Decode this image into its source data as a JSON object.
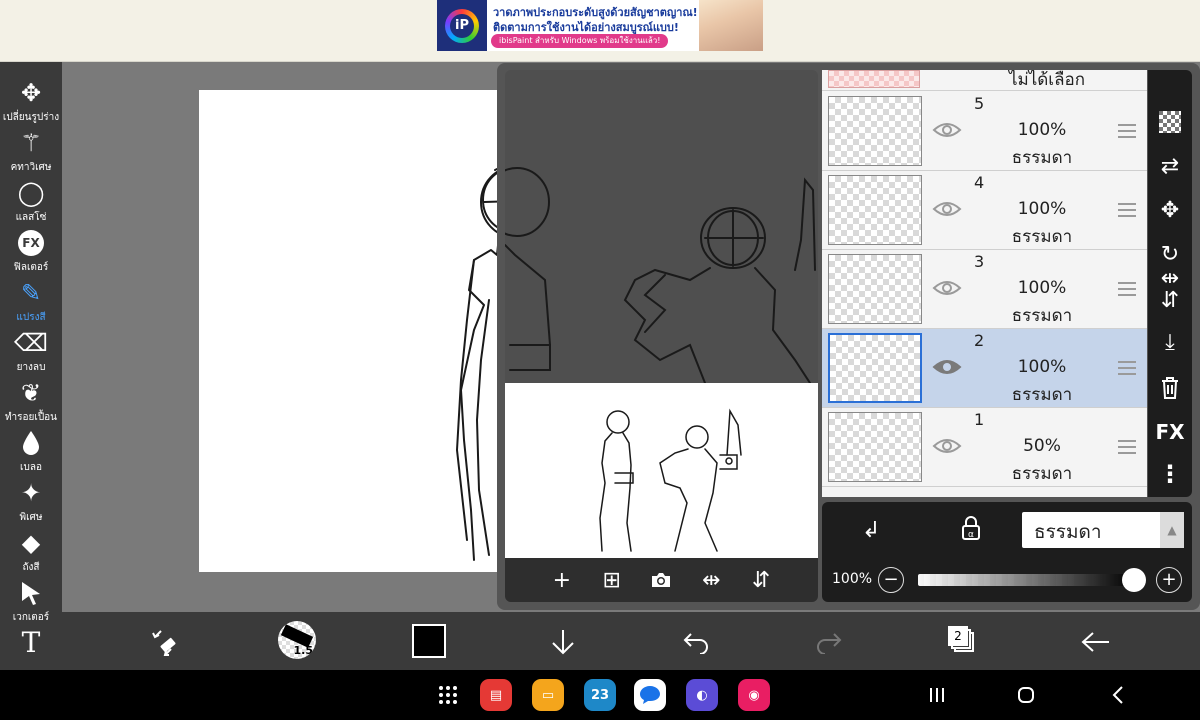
{
  "ad": {
    "line1": "วาดภาพประกอบระดับสูงด้วยสัญชาตญาณ!",
    "line2": "ติดตามการใช้งานได้อย่างสมบูรณ์แบบ!",
    "cta": "ibisPaint สำหรับ Windows พร้อมใช้งานแล้ว!",
    "logo": "iP"
  },
  "tools": [
    {
      "label": "เปลี่ยนรูปร่าง",
      "icon": "move-icon",
      "glyph": "✥"
    },
    {
      "label": "คทาวิเศษ",
      "icon": "magic-wand-icon",
      "glyph": "⚚"
    },
    {
      "label": "แลสโซ่",
      "icon": "lasso-icon",
      "glyph": "◯"
    },
    {
      "label": "ฟิลเตอร์",
      "icon": "filter-fx-icon",
      "glyph": "FX"
    },
    {
      "label": "แปรงสี",
      "icon": "brush-icon",
      "glyph": "✎"
    },
    {
      "label": "ยางลบ",
      "icon": "eraser-icon",
      "glyph": "⌫"
    },
    {
      "label": "ทำรอยเปื้อน",
      "icon": "smudge-icon",
      "glyph": "❦"
    },
    {
      "label": "เบลอ",
      "icon": "blur-drop-icon",
      "glyph": "💧"
    },
    {
      "label": "พิเศษ",
      "icon": "special-sparkle-icon",
      "glyph": "✦"
    },
    {
      "label": "ถังสี",
      "icon": "fill-bucket-icon",
      "glyph": "◆"
    },
    {
      "label": "เวกเตอร์",
      "icon": "vector-cursor-icon",
      "glyph": "➤"
    },
    {
      "label": "",
      "icon": "text-tool-icon",
      "glyph": "T"
    }
  ],
  "active_tool": "แปรงสี",
  "layer_panel": {
    "no_selection": "ไม่ได้เลือก",
    "layers": [
      {
        "number": "5",
        "opacity": "100%",
        "blend": "ธรรมดา",
        "selected": false
      },
      {
        "number": "4",
        "opacity": "100%",
        "blend": "ธรรมดา",
        "selected": false
      },
      {
        "number": "3",
        "opacity": "100%",
        "blend": "ธรรมดา",
        "selected": false
      },
      {
        "number": "2",
        "opacity": "100%",
        "blend": "ธรรมดา",
        "selected": true
      },
      {
        "number": "1",
        "opacity": "50%",
        "blend": "ธรรมดา",
        "selected": false
      }
    ],
    "blend_mode": "ธรรมดา",
    "opacity_label": "100%",
    "opacity_value": 1.0,
    "fx_label": "FX"
  },
  "preview_actions": [
    {
      "icon": "add-layer-icon",
      "glyph": "+"
    },
    {
      "icon": "add-special-layer-icon",
      "glyph": "⊞"
    },
    {
      "icon": "camera-icon",
      "glyph": "📷"
    },
    {
      "icon": "flip-horizontal-icon",
      "glyph": "⇹"
    },
    {
      "icon": "flip-vertical-icon",
      "glyph": "⇵"
    }
  ],
  "bottom": {
    "brush_size": "1.5",
    "color": "#000000",
    "layer_count": "2"
  },
  "nav_apps": [
    {
      "icon": "app-drawer-icon",
      "color": "#000000",
      "glyph": "⋮⋮⋮"
    },
    {
      "icon": "notes-app-icon",
      "color": "#e53935",
      "glyph": "▤"
    },
    {
      "icon": "files-app-icon",
      "color": "#f4a51c",
      "glyph": "▭"
    },
    {
      "icon": "calendar-app-icon",
      "color": "#1e88c8",
      "glyph": "23"
    },
    {
      "icon": "messages-app-icon",
      "color": "#1a73e8",
      "glyph": "💬"
    },
    {
      "icon": "internet-app-icon",
      "color": "#5b4cd6",
      "glyph": "◐"
    },
    {
      "icon": "screen-recorder-app-icon",
      "color": "#e91e63",
      "glyph": "◉"
    }
  ]
}
